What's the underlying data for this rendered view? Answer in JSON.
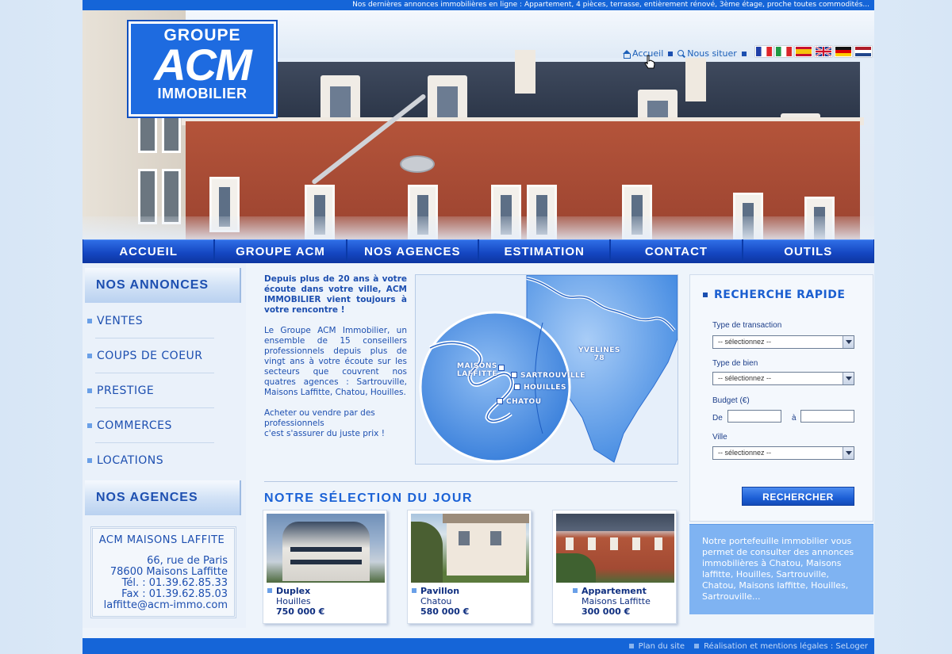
{
  "ticker": "Nos dernières annonces immobilières en ligne : Appartement, 4 pièces, terrasse, entièrement rénové, 3ème étage, proche toutes commodités...",
  "logo": {
    "line1": "GROUPE",
    "line2": "ACM",
    "line3": "IMMOBILIER"
  },
  "toplinks": {
    "home": "Accueil",
    "locate": "Nous situer"
  },
  "flags": [
    "fr",
    "it",
    "es",
    "gb",
    "de",
    "nl"
  ],
  "nav": [
    "ACCUEIL",
    "GROUPE ACM",
    "NOS AGENCES",
    "ESTIMATION",
    "CONTACT",
    "OUTILS"
  ],
  "left": {
    "annonces_title": "NOS ANNONCES",
    "menu": [
      "VENTES",
      "COUPS DE COEUR",
      "PRESTIGE",
      "COMMERCES",
      "LOCATIONS"
    ],
    "agences_title": "NOS AGENCES",
    "agency": {
      "name": "ACM MAISONS LAFFITE",
      "street": "66, rue de Paris",
      "city": "78600 Maisons Laffitte",
      "tel": "Tél. : 01.39.62.85.33",
      "fax": "Fax : 01.39.62.85.03",
      "email": "laffitte@acm-immo.com"
    }
  },
  "intro": {
    "lead": "Depuis plus de 20 ans à votre écoute dans votre ville, ACM IMMOBILIER vient toujours à votre rencontre !",
    "body": "Le Groupe ACM Immobilier, un ensemble de 15 conseillers professionnels depuis plus de vingt ans à votre écoute sur les secteurs que couvrent nos quatres agences : Sartrouville, Maisons Laffitte, Chatou, Houilles.",
    "closing1": "Acheter ou vendre par des professionnels",
    "closing2": "c'est s'assurer du juste prix !"
  },
  "map": {
    "region": "YVELINES",
    "region_num": "78",
    "towns": [
      "MAISONS LAFFITTE",
      "SARTROUVILLE",
      "HOUILLES",
      "CHATOU"
    ]
  },
  "selection": {
    "title": "NOTRE SÉLECTION DU JOUR",
    "cards": [
      {
        "type": "Duplex",
        "town": "Houilles",
        "price": "750 000 €"
      },
      {
        "type": "Pavillon",
        "town": "Chatou",
        "price": "580 000 €"
      },
      {
        "type": "Appartement",
        "town": "Maisons Laffitte",
        "price": "300 000 €"
      }
    ]
  },
  "search": {
    "title": "RECHERCHE RAPIDE",
    "transaction_label": "Type de transaction",
    "bien_label": "Type de bien",
    "budget_label": "Budget (€)",
    "de_label": "De",
    "a_label": "à",
    "ville_label": "Ville",
    "select_placeholder": "-- sélectionnez --",
    "button": "RECHERCHER"
  },
  "portfolio": "Notre portefeuille immobilier vous permet de consulter des annonces immobilières à Chatou, Maisons laffitte, Houilles, Sartrouville, Chatou, Maisons laffitte, Houilles, Sartrouville...",
  "footer": {
    "plan": "Plan du site",
    "credits": "Réalisation et mentions légales : SeLoger"
  }
}
